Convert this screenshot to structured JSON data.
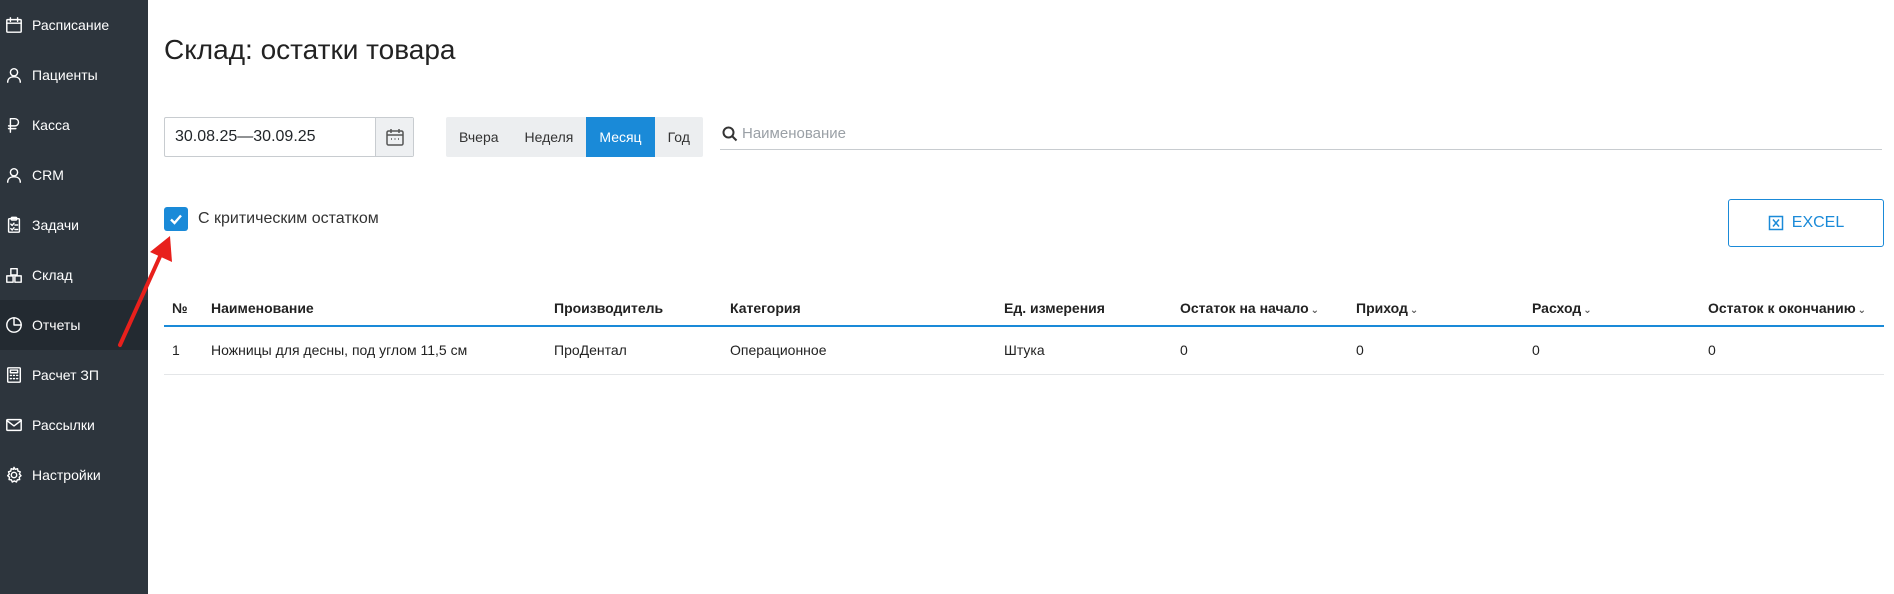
{
  "sidebar": {
    "items": [
      {
        "label": "Расписание",
        "icon": "calendar-icon"
      },
      {
        "label": "Пациенты",
        "icon": "user-icon"
      },
      {
        "label": "Касса",
        "icon": "ruble-icon"
      },
      {
        "label": "CRM",
        "icon": "user-icon"
      },
      {
        "label": "Задачи",
        "icon": "clipboard-icon"
      },
      {
        "label": "Склад",
        "icon": "boxes-icon"
      },
      {
        "label": "Отчеты",
        "icon": "pie-chart-icon"
      },
      {
        "label": "Расчет ЗП",
        "icon": "calculator-icon"
      },
      {
        "label": "Рассылки",
        "icon": "mail-icon"
      },
      {
        "label": "Настройки",
        "icon": "gear-icon"
      }
    ],
    "active_index": 6
  },
  "main": {
    "title": "Склад: остатки товара",
    "date_range": "30.08.25—30.09.25",
    "periods": [
      "Вчера",
      "Неделя",
      "Месяц",
      "Год"
    ],
    "active_period": "Месяц",
    "search_placeholder": "Наименование",
    "checkbox_label": "С критическим остатком",
    "checkbox_checked": true,
    "excel_label": "EXCEL"
  },
  "table": {
    "columns": [
      "№",
      "Наименование",
      "Производитель",
      "Категория",
      "Ед. измерения",
      "Остаток на начало",
      "Приход",
      "Расход",
      "Остаток к окончанию"
    ],
    "rows": [
      [
        "1",
        "Ножницы для десны, под углом 11,5 см",
        "ПроДентал",
        "Операционное",
        "Штука",
        "0",
        "0",
        "0",
        "0"
      ]
    ]
  },
  "colors": {
    "sidebar_bg": "#2d353d",
    "accent": "#1a8ad8",
    "annotation": "#e8201c"
  }
}
